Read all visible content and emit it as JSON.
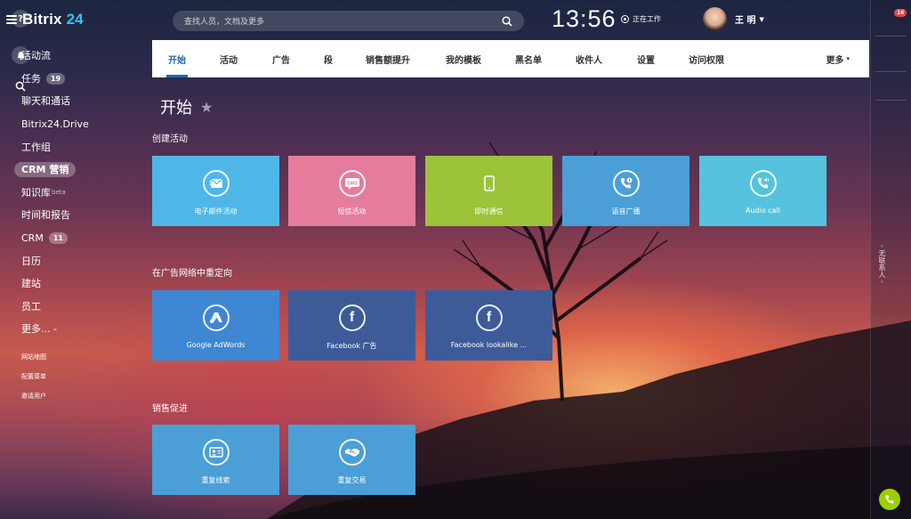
{
  "app": {
    "logo_main": "Bitrix",
    "logo_accent": "24"
  },
  "sidebar": {
    "items": [
      {
        "label": "活动流"
      },
      {
        "label": "任务",
        "counter": "19"
      },
      {
        "label": "聊天和通话"
      },
      {
        "label": "Bitrix24.Drive"
      },
      {
        "label": "工作组"
      },
      {
        "label": "CRM 营销",
        "active": true
      },
      {
        "label": "知识库",
        "beta": "beta"
      },
      {
        "label": "时间和报告"
      },
      {
        "label": "CRM",
        "counter": "11"
      },
      {
        "label": "日历"
      },
      {
        "label": "建站"
      },
      {
        "label": "员工"
      },
      {
        "label": "更多... -"
      }
    ],
    "small_links": [
      "网站地图",
      "配置菜单",
      "邀请用户"
    ]
  },
  "header": {
    "search_placeholder": "查找人员，文档及更多",
    "clock": "13:56",
    "work_status": "正在工作",
    "user_name": "王 明"
  },
  "right_panel": {
    "help_badge": "16",
    "vertical_text": "- 无联系人 -"
  },
  "tabs": [
    "开始",
    "活动",
    "广告",
    "段",
    "销售额提升",
    "我的模板",
    "黑名单",
    "收件人",
    "设置",
    "访问权限"
  ],
  "tabs_more": "更多",
  "page": {
    "title": "开始",
    "sections": [
      {
        "title": "创建活动",
        "tiles": [
          {
            "label": "电子邮件活动",
            "icon": "email-icon",
            "color": "#4fb7e8"
          },
          {
            "label": "短信活动",
            "icon": "sms-icon",
            "color": "#e67c9c"
          },
          {
            "label": "即时通信",
            "icon": "mobile-icon",
            "color": "#9dc33a"
          },
          {
            "label": "语音广播",
            "icon": "voice-broadcast-icon",
            "color": "#4b9fd6"
          },
          {
            "label": "Audio call",
            "icon": "audio-call-icon",
            "color": "#55c3de"
          }
        ]
      },
      {
        "title": "在广告网络中重定向",
        "tiles": [
          {
            "label": "Google AdWords",
            "icon": "google-ads-icon",
            "color": "#3f86d3"
          },
          {
            "label": "Facebook 广告",
            "icon": "facebook-icon",
            "color": "#3d5b99"
          },
          {
            "label": "Facebook lookalike ...",
            "icon": "facebook-icon",
            "color": "#3d5b99"
          }
        ]
      },
      {
        "title": "销售促进",
        "tiles": [
          {
            "label": "重复线索",
            "icon": "repeat-lead-icon",
            "color": "#4b9fd6"
          },
          {
            "label": "重复交易",
            "icon": "handshake-icon",
            "color": "#4b9fd6"
          }
        ]
      }
    ]
  }
}
